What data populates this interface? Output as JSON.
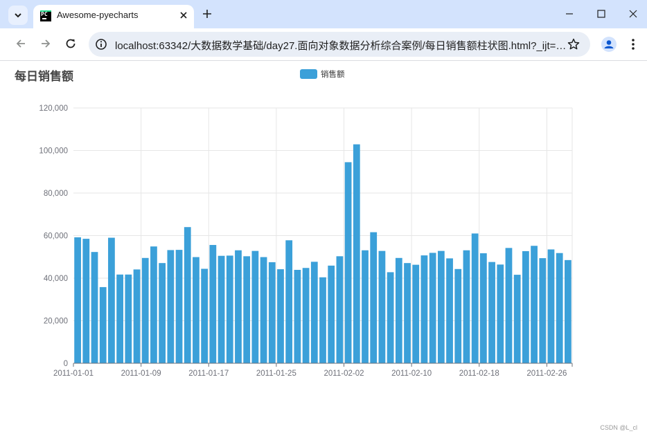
{
  "browser": {
    "tab_title": "Awesome-pyecharts",
    "favicon_text": "PC",
    "url": "localhost:63342/大数据数学基础/day27.面向对象数据分析综合案例/每日销售额柱状图.html?_ijt=1fa...",
    "icons": [
      "tab-list-icon",
      "close-icon",
      "plus-icon",
      "minimize-icon",
      "maximize-icon",
      "close-window-icon",
      "back-icon",
      "forward-icon",
      "reload-icon",
      "site-info-icon",
      "star-icon",
      "profile-icon",
      "menu-icon"
    ]
  },
  "chart_data": {
    "type": "bar",
    "title": "每日销售额",
    "legend": [
      "销售额"
    ],
    "legend_position": "top-center",
    "color": "#3ba0d9",
    "grid": true,
    "ylim": [
      0,
      120000
    ],
    "y_ticks": [
      "0",
      "20,000",
      "40,000",
      "60,000",
      "80,000",
      "100,000",
      "120,000"
    ],
    "x_tick_labels": [
      "2011-01-01",
      "2011-01-09",
      "2011-01-17",
      "2011-01-25",
      "2011-02-02",
      "2011-02-10",
      "2011-02-18",
      "2011-02-26"
    ],
    "categories": [
      "2011-01-01",
      "2011-01-02",
      "2011-01-03",
      "2011-01-04",
      "2011-01-05",
      "2011-01-06",
      "2011-01-07",
      "2011-01-08",
      "2011-01-09",
      "2011-01-10",
      "2011-01-11",
      "2011-01-12",
      "2011-01-13",
      "2011-01-14",
      "2011-01-15",
      "2011-01-16",
      "2011-01-17",
      "2011-01-18",
      "2011-01-19",
      "2011-01-20",
      "2011-01-21",
      "2011-01-22",
      "2011-01-23",
      "2011-01-24",
      "2011-01-25",
      "2011-01-26",
      "2011-01-27",
      "2011-01-28",
      "2011-01-29",
      "2011-01-30",
      "2011-01-31",
      "2011-02-01",
      "2011-02-02",
      "2011-02-03",
      "2011-02-04",
      "2011-02-05",
      "2011-02-06",
      "2011-02-07",
      "2011-02-08",
      "2011-02-09",
      "2011-02-10",
      "2011-02-11",
      "2011-02-12",
      "2011-02-13",
      "2011-02-14",
      "2011-02-15",
      "2011-02-16",
      "2011-02-17",
      "2011-02-18",
      "2011-02-19",
      "2011-02-20",
      "2011-02-21",
      "2011-02-22",
      "2011-02-23",
      "2011-02-24",
      "2011-02-25",
      "2011-02-26",
      "2011-02-27",
      "2011-02-28"
    ],
    "series": [
      {
        "name": "销售额",
        "values": [
          59200,
          58500,
          52300,
          35800,
          59000,
          41700,
          41700,
          44100,
          49500,
          54900,
          47100,
          53200,
          53300,
          64000,
          49900,
          44400,
          55600,
          50500,
          50600,
          53100,
          50300,
          52800,
          49900,
          47500,
          44200,
          57800,
          43900,
          44800,
          47700,
          40400,
          45900,
          50300,
          94500,
          102900,
          53100,
          61600,
          52800,
          42800,
          49500,
          47100,
          46300,
          50700,
          51900,
          52800,
          49300,
          44300,
          53100,
          61000,
          51700,
          47600,
          46400,
          54200,
          41600,
          52700,
          55200,
          49400,
          53500,
          51800,
          48500
        ]
      }
    ]
  },
  "watermark": "CSDN @L_cl"
}
